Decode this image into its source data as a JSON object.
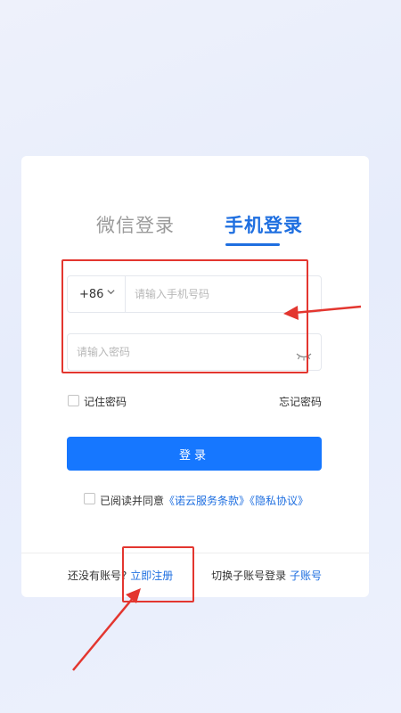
{
  "tabs": {
    "wechat": "微信登录",
    "phone": "手机登录"
  },
  "phone": {
    "country_code": "+86",
    "placeholder": "请输入手机号码",
    "value": ""
  },
  "password": {
    "placeholder": "请输入密码",
    "value": ""
  },
  "remember_label": "记住密码",
  "forgot_label": "忘记密码",
  "login_label": "登录",
  "agreement": {
    "prefix": "已阅读并同意",
    "service_terms": "《诺云服务条款》",
    "privacy_policy": "《隐私协议》"
  },
  "bottom": {
    "no_account": "还没有账号?",
    "register": "立即注册",
    "switch_sub": "切换子账号登录",
    "sub_account": "子账号"
  },
  "icons": {
    "country_dropdown": "chevron-down-icon",
    "password_toggle": "eye-closed-icon"
  },
  "colors": {
    "accent": "#1677ff",
    "link": "#1f6fe0",
    "annotation": "#e3362f"
  }
}
